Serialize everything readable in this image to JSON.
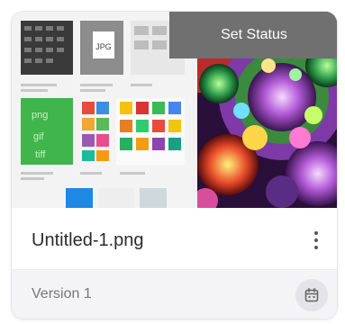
{
  "card": {
    "filename": "Untitled-1.png",
    "version_label": "Version 1",
    "set_status_label": "Set Status"
  },
  "thumbnail_texts": {
    "jpg": "JPG",
    "png": "png",
    "gif": "gif",
    "tiff": "tiff"
  },
  "icons": {
    "more": "more-vertical-icon",
    "calendar": "calendar-icon"
  },
  "colors": {
    "status_overlay": "#707070",
    "footer_bg": "#f4f4f6",
    "icon_bg": "#e4e4e8"
  }
}
